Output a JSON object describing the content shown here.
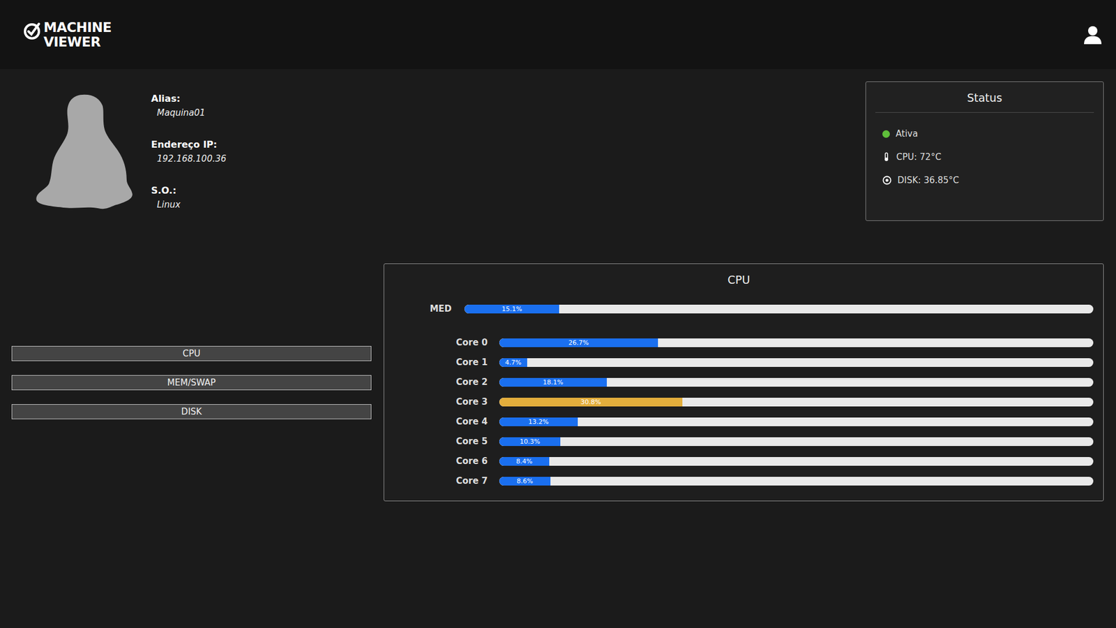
{
  "header": {
    "logo": [
      "MACHINE",
      "VIEWER"
    ]
  },
  "machine": {
    "fields": [
      {
        "label": "Alias:",
        "value": "Maquina01"
      },
      {
        "label": "Endereço IP:",
        "value": "192.168.100.36"
      },
      {
        "label": "S.O.:",
        "value": "Linux"
      }
    ]
  },
  "status": {
    "title": "Status",
    "items": [
      {
        "kind": "dot",
        "text": "Ativa",
        "on": true
      },
      {
        "kind": "thermometer",
        "text": "CPU: 72°C"
      },
      {
        "kind": "disk",
        "text": "DISK: 36.85°C"
      }
    ]
  },
  "nav": [
    {
      "label": "CPU"
    },
    {
      "label": "MEM/SWAP"
    },
    {
      "label": "DISK"
    }
  ],
  "cpu": {
    "title": "CPU",
    "average": {
      "label": "MED",
      "level": 0.151,
      "reading": "15.1%",
      "color": "#1a6fef"
    },
    "cores": [
      {
        "label": "Core 0",
        "level": 0.267,
        "reading": "26.7%",
        "color": "#1a6fef"
      },
      {
        "label": "Core 1",
        "level": 0.047,
        "reading": "4.7%",
        "color": "#1a6fef"
      },
      {
        "label": "Core 2",
        "level": 0.181,
        "reading": "18.1%",
        "color": "#1a6fef"
      },
      {
        "label": "Core 3",
        "level": 0.308,
        "reading": "30.8%",
        "color": "#e3ae3c"
      },
      {
        "label": "Core 4",
        "level": 0.132,
        "reading": "13.2%",
        "color": "#1a6fef"
      },
      {
        "label": "Core 5",
        "level": 0.103,
        "reading": "10.3%",
        "color": "#1a6fef"
      },
      {
        "label": "Core 6",
        "level": 0.084,
        "reading": "8.4%",
        "color": "#1a6fef"
      },
      {
        "label": "Core 7",
        "level": 0.086,
        "reading": "8.6%",
        "color": "#1a6fef"
      }
    ]
  }
}
